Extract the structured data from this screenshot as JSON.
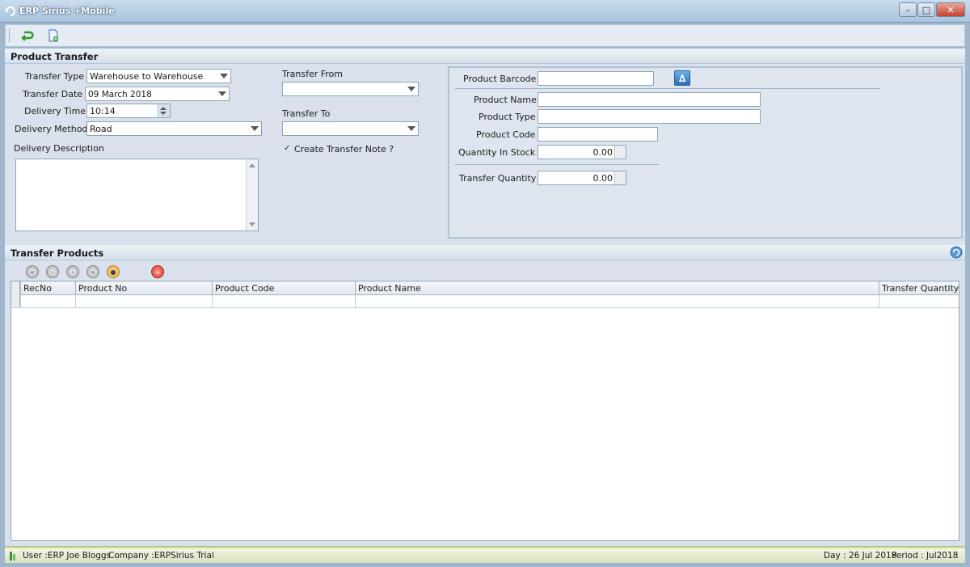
{
  "window": {
    "title": "ERP Sirius +Mobile",
    "controls": [
      "minimize-icon",
      "maximize-icon",
      "close-icon"
    ]
  },
  "toolbar": {
    "icons": [
      "return-icon",
      "new-document-icon"
    ]
  },
  "product_transfer": {
    "heading": "Product Transfer",
    "transfer_type": {
      "label": "Transfer Type",
      "value": "Warehouse to Warehouse"
    },
    "transfer_date": {
      "label": "Transfer Date",
      "value": "09 March 2018"
    },
    "delivery_time": {
      "label": "Delivery Time",
      "value": "10:14"
    },
    "delivery_method": {
      "label": "Delivery Method",
      "value": "Road"
    },
    "delivery_description": {
      "label": "Delivery Description",
      "value": ""
    },
    "transfer_from": {
      "label": "Transfer From",
      "value": ""
    },
    "transfer_to": {
      "label": "Transfer To",
      "value": ""
    },
    "create_transfer_note": {
      "label": "Create Transfer Note ?",
      "checked": true
    },
    "product_barcode": {
      "label": "Product Barcode",
      "value": ""
    },
    "product_name": {
      "label": "Product Name",
      "value": ""
    },
    "product_type": {
      "label": "Product Type",
      "value": ""
    },
    "product_code": {
      "label": "Product Code",
      "value": ""
    },
    "quantity_in_stock": {
      "label": "Quantity In Stock",
      "value": "0.00"
    },
    "transfer_quantity": {
      "label": "Transfer Quantity",
      "value": "0.00"
    }
  },
  "transfer_products": {
    "heading": "Transfer Products",
    "nav_icons": [
      "first-icon",
      "prev-icon",
      "next-icon",
      "last-icon",
      "refresh-icon",
      "delete-icon"
    ],
    "columns": [
      "RecNo",
      "Product No",
      "Product Code",
      "Product Name",
      "Transfer Quantity"
    ],
    "rows": []
  },
  "status": {
    "user": "User :ERP Joe Bloggs",
    "company": "Company :ERPSirius Trial",
    "day": "Day : 26 Jul 2018",
    "period": "Period : Jul2018"
  }
}
